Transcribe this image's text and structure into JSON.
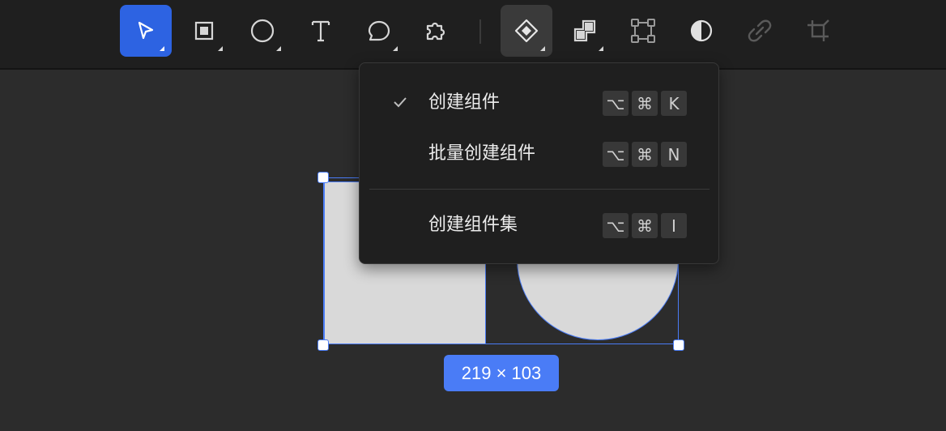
{
  "toolbar": {
    "tools": [
      {
        "name": "select",
        "icon": "cursor-arrow-icon",
        "active": true,
        "has_dropdown": true
      },
      {
        "name": "frame",
        "icon": "frame-square-icon",
        "has_dropdown": true
      },
      {
        "name": "ellipse",
        "icon": "circle-icon",
        "has_dropdown": true
      },
      {
        "name": "text",
        "icon": "text-t-icon",
        "has_dropdown": false
      },
      {
        "name": "comment",
        "icon": "speech-bubble-icon",
        "has_dropdown": true
      },
      {
        "name": "plugin",
        "icon": "puzzle-icon",
        "has_dropdown": false
      },
      {
        "name": "component",
        "icon": "component-diamond-icon",
        "hover": true,
        "has_dropdown": true
      },
      {
        "name": "boolean",
        "icon": "boolean-union-icon",
        "has_dropdown": true
      },
      {
        "name": "vector-points",
        "icon": "bounding-box-icon",
        "has_dropdown": false
      },
      {
        "name": "mask",
        "icon": "contrast-mask-icon",
        "has_dropdown": false
      },
      {
        "name": "link",
        "icon": "link-icon",
        "disabled": true
      },
      {
        "name": "crop",
        "icon": "crop-icon",
        "disabled": true
      }
    ]
  },
  "component_menu": {
    "items": [
      {
        "label": "创建组件",
        "checked": true,
        "shortcut": [
          "⌥",
          "⌘",
          "K"
        ]
      },
      {
        "label": "批量创建组件",
        "checked": false,
        "shortcut": [
          "⌥",
          "⌘",
          "N"
        ]
      },
      {
        "label": "创建组件集",
        "checked": false,
        "shortcut": [
          "⌥",
          "⌘",
          "I"
        ]
      }
    ]
  },
  "selection": {
    "size_label": "219 × 103"
  },
  "colors": {
    "accent": "#4a7cf6",
    "active_tool": "#2d63e2",
    "toolbar_bg": "#1f1f1f",
    "canvas_bg": "#2c2c2c",
    "shape_fill": "#d9d9d9"
  }
}
